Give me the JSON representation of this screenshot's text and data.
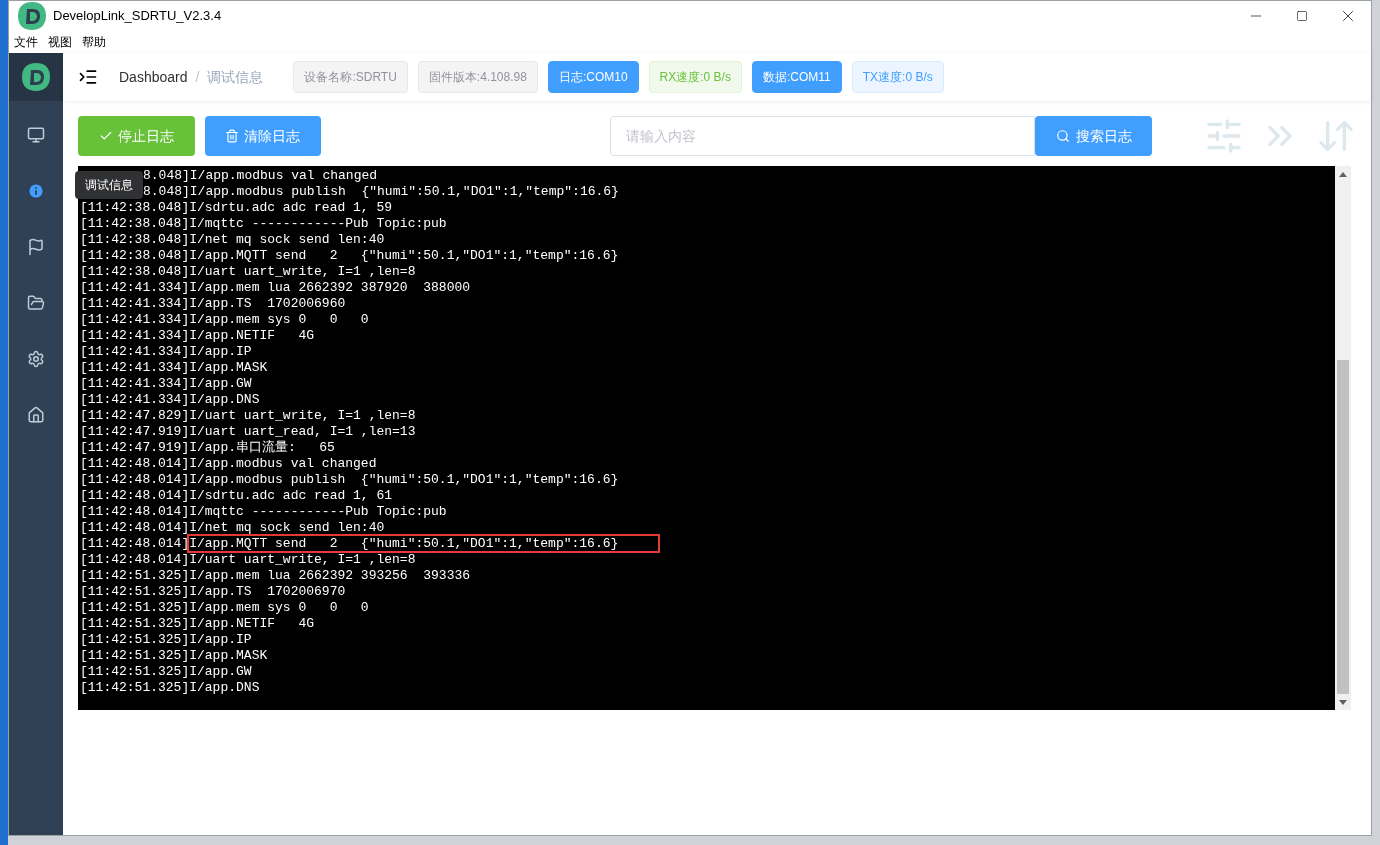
{
  "window": {
    "title": "DevelopLink_SDRTU_V2.3.4"
  },
  "menu": [
    "文件",
    "视图",
    "帮助"
  ],
  "sidebar": {
    "items": [
      {
        "selected": false
      },
      {
        "selected": true
      },
      {
        "selected": false
      },
      {
        "selected": false
      },
      {
        "selected": false
      },
      {
        "selected": false
      }
    ],
    "tooltip": "调试信息"
  },
  "breadcrumb": {
    "items": [
      "Dashboard",
      "调试信息"
    ],
    "separator": "/"
  },
  "badges": [
    {
      "label": "设备名称:SDRTU",
      "kind": "gray"
    },
    {
      "label": "固件版本:4.108.98",
      "kind": "gray"
    },
    {
      "label": "日志:COM10",
      "kind": "primary"
    },
    {
      "label": "RX速度:0 B/s",
      "kind": "success"
    },
    {
      "label": "数据:COM11",
      "kind": "primary"
    },
    {
      "label": "TX速度:0 B/s",
      "kind": "info"
    }
  ],
  "toolbar": {
    "stop_button": "停止日志",
    "clear_button": "清除日志",
    "search": {
      "placeholder": "请输入内容"
    },
    "search_button": "搜索日志"
  },
  "log": [
    {
      "time": "8.048]",
      "message": "I/app.modbus val changed",
      "highlighted": false,
      "kind": "covered"
    },
    {
      "time": "8.048]",
      "message": "I/app.modbus publish  {\"humi\":50.1,\"DO1\":1,\"temp\":16.6}",
      "highlighted": false,
      "kind": "covered"
    },
    {
      "time": "[11:42:38.048]",
      "message": "I/sdrtu.adc adc read 1, 59",
      "highlighted": false
    },
    {
      "time": "[11:42:38.048]",
      "message": "I/mqttc ------------Pub Topic:pub",
      "highlighted": false
    },
    {
      "time": "[11:42:38.048]",
      "message": "I/net mq sock send len:40",
      "highlighted": false
    },
    {
      "time": "[11:42:38.048]",
      "message": "I/app.MQTT send   2   {\"humi\":50.1,\"DO1\":1,\"temp\":16.6}",
      "highlighted": false
    },
    {
      "time": "[11:42:38.048]",
      "message": "I/uart uart_write, I=1 ,len=8",
      "highlighted": false
    },
    {
      "time": "[11:42:41.334]",
      "message": "I/app.mem lua 2662392 387920  388000",
      "highlighted": false
    },
    {
      "time": "[11:42:41.334]",
      "message": "I/app.TS  1702006960",
      "highlighted": false
    },
    {
      "time": "[11:42:41.334]",
      "message": "I/app.mem sys 0   0   0",
      "highlighted": false
    },
    {
      "time": "[11:42:41.334]",
      "message": "I/app.NETIF   4G",
      "highlighted": false
    },
    {
      "time": "[11:42:41.334]",
      "message": "I/app.IP",
      "highlighted": false
    },
    {
      "time": "[11:42:41.334]",
      "message": "I/app.MASK",
      "highlighted": false
    },
    {
      "time": "[11:42:41.334]",
      "message": "I/app.GW",
      "highlighted": false
    },
    {
      "time": "[11:42:41.334]",
      "message": "I/app.DNS",
      "highlighted": false
    },
    {
      "time": "[11:42:47.829]",
      "message": "I/uart uart_write, I=1 ,len=8",
      "highlighted": false
    },
    {
      "time": "[11:42:47.919]",
      "message": "I/uart uart_read, I=1 ,len=13",
      "highlighted": false
    },
    {
      "time": "[11:42:47.919]",
      "message": "I/app.串口流量:   65",
      "highlighted": false
    },
    {
      "time": "[11:42:48.014]",
      "message": "I/app.modbus val changed",
      "highlighted": false
    },
    {
      "time": "[11:42:48.014]",
      "message": "I/app.modbus publish  {\"humi\":50.1,\"DO1\":1,\"temp\":16.6}",
      "highlighted": false
    },
    {
      "time": "[11:42:48.014]",
      "message": "I/sdrtu.adc adc read 1, 61",
      "highlighted": false
    },
    {
      "time": "[11:42:48.014]",
      "message": "I/mqttc ------------Pub Topic:pub",
      "highlighted": false
    },
    {
      "time": "[11:42:48.014]",
      "message": "I/net mq sock send len:40",
      "highlighted": false
    },
    {
      "time": "[11:42:48.014]",
      "message": "I/app.MQTT send   2   {\"humi\":50.1,\"DO1\":1,\"temp\":16.6}",
      "highlighted": true
    },
    {
      "time": "[11:42:48.014]",
      "message": "I/uart uart_write, I=1 ,len=8",
      "highlighted": false
    },
    {
      "time": "[11:42:51.325]",
      "message": "I/app.mem lua 2662392 393256  393336",
      "highlighted": false
    },
    {
      "time": "[11:42:51.325]",
      "message": "I/app.TS  1702006970",
      "highlighted": false
    },
    {
      "time": "[11:42:51.325]",
      "message": "I/app.mem sys 0   0   0",
      "highlighted": false
    },
    {
      "time": "[11:42:51.325]",
      "message": "I/app.NETIF   4G",
      "highlighted": false
    },
    {
      "time": "[11:42:51.325]",
      "message": "I/app.IP",
      "highlighted": false
    },
    {
      "time": "[11:42:51.325]",
      "message": "I/app.MASK",
      "highlighted": false
    },
    {
      "time": "[11:42:51.325]",
      "message": "I/app.GW",
      "highlighted": false
    },
    {
      "time": "[11:42:51.325]",
      "message": "I/app.DNS",
      "highlighted": false
    }
  ]
}
